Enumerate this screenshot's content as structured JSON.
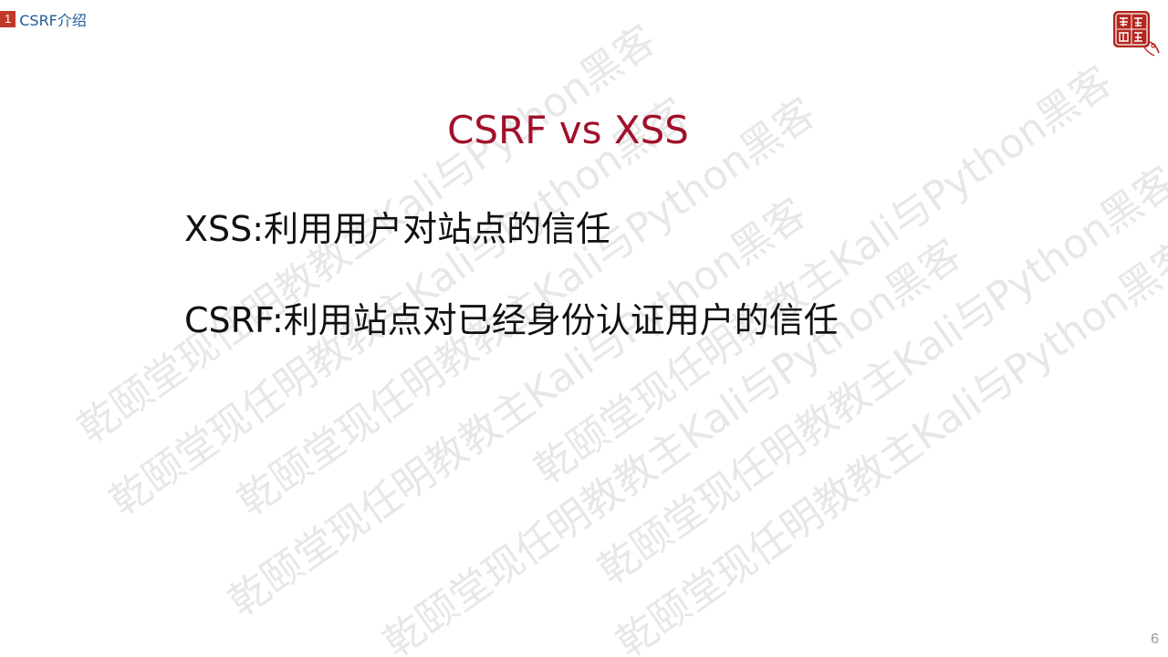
{
  "header": {
    "section_number": "1",
    "section_title": "CSRF介绍"
  },
  "logo": {
    "icon": "seal-logo-icon",
    "color": "#b3261e"
  },
  "watermark": {
    "text": "乾颐堂现任明教教主Kali与Python黑客"
  },
  "slide": {
    "title": "CSRF vs XSS",
    "points": [
      "XSS:利用用户对站点的信任",
      "CSRF:利用站点对已经身份认证用户的信任"
    ],
    "page_number": "6"
  },
  "colors": {
    "title": "#a0112b",
    "section_badge": "#c0392b",
    "section_title": "#1f5c99"
  }
}
